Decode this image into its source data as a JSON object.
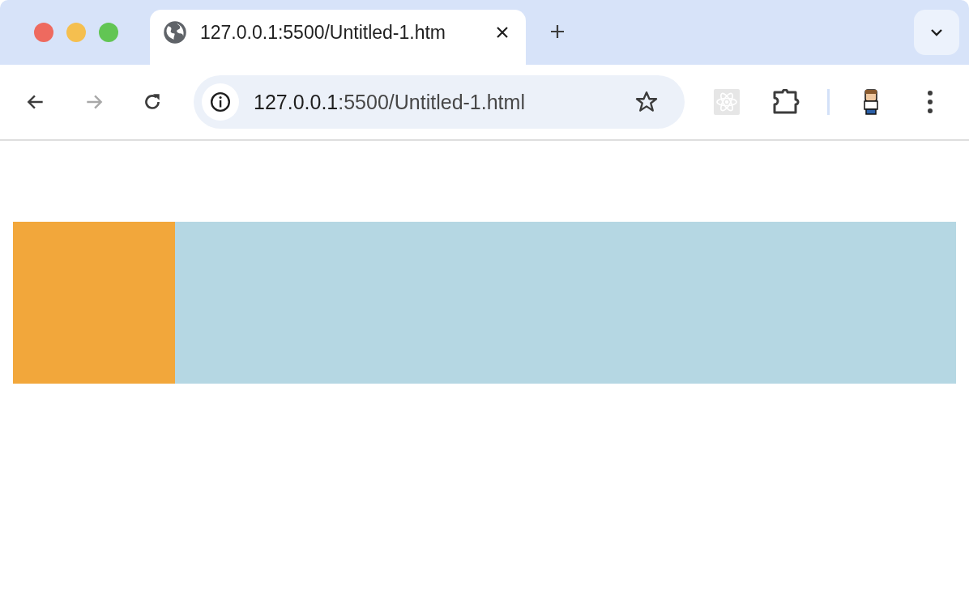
{
  "window": {
    "traffic_lights": [
      {
        "color": "#ee6a5f"
      },
      {
        "color": "#f5bf4f"
      },
      {
        "color": "#62c554"
      }
    ]
  },
  "tabs": [
    {
      "title": "127.0.0.1:5500/Untitled-1.htm",
      "selected": true
    }
  ],
  "toolbar": {
    "address": {
      "host": "127.0.0.1",
      "path": ":5500/Untitled-1.html"
    },
    "forward_disabled": true
  },
  "page": {
    "blocks": [
      {
        "color": "#f2a73b"
      },
      {
        "color": "#b5d7e3"
      }
    ]
  }
}
